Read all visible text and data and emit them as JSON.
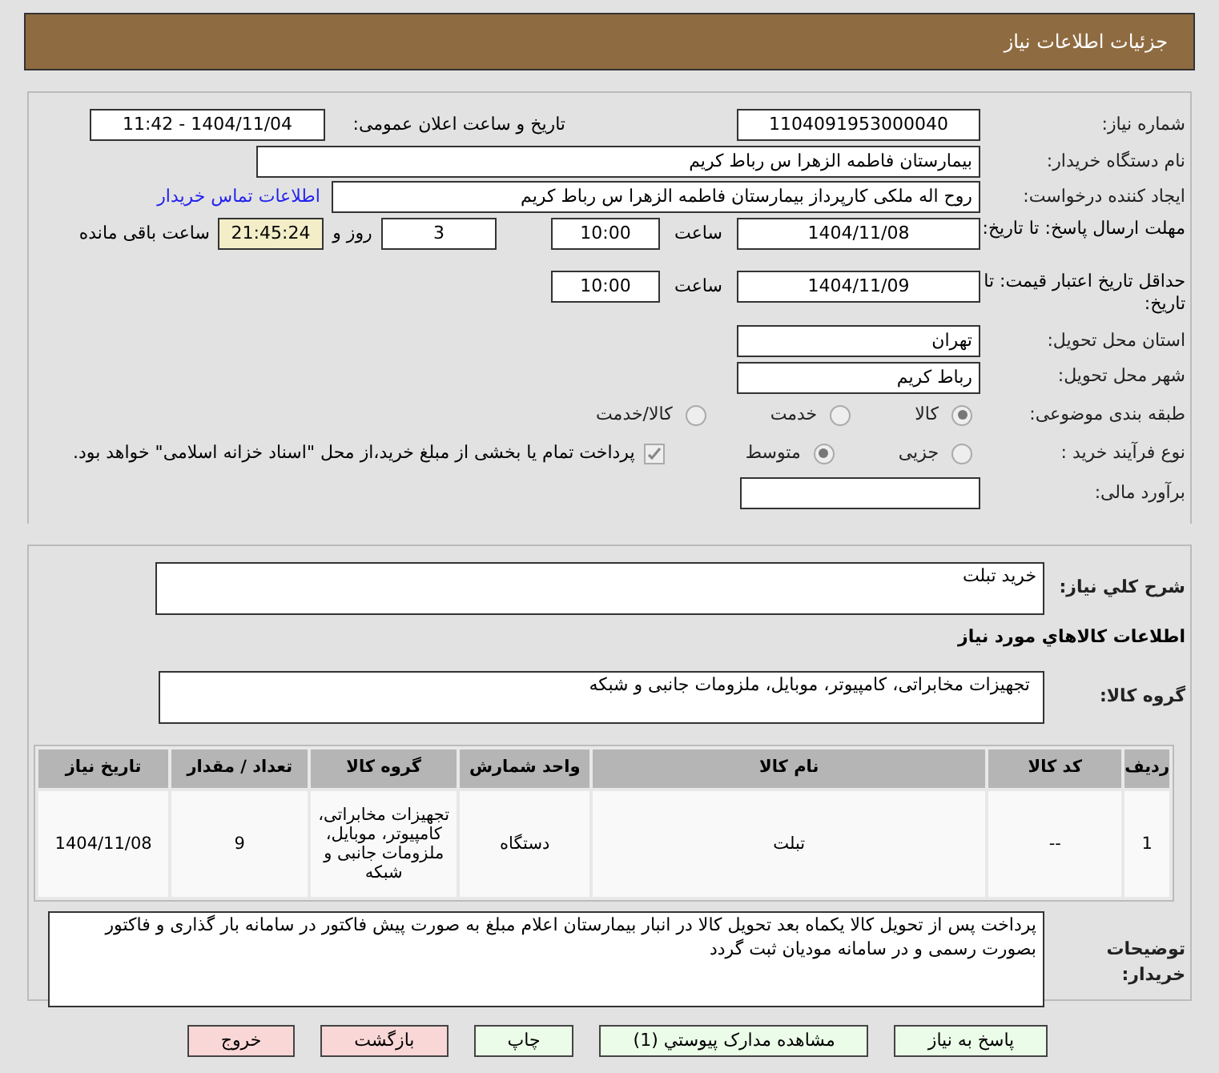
{
  "header": {
    "title": "جزئیات اطلاعات نیاز"
  },
  "need_number": {
    "label": "شماره نیاز:",
    "value": "1104091953000040"
  },
  "announce": {
    "label": "تاریخ و ساعت اعلان عمومی:",
    "value": "1404/11/04 - 11:42"
  },
  "buyer": {
    "label": "نام دستگاه خریدار:",
    "value": "بیمارستان فاطمه الزهرا س  رباط کریم"
  },
  "creator": {
    "label": "ایجاد کننده درخواست:",
    "value": "روح اله ملکی کارپرداز  بیمارستان فاطمه الزهرا س  رباط کریم",
    "link": "اطلاعات تماس خریدار"
  },
  "reply_deadline": {
    "label": "مهلت ارسال پاسخ: تا تاریخ:",
    "date": "1404/11/08",
    "time_label": "ساعت",
    "time": "10:00",
    "days": "3",
    "days_label": "روز و",
    "remaining": "21:45:24",
    "remaining_label": "ساعت باقی مانده"
  },
  "price_validity": {
    "label": "حداقل تاریخ اعتبار قیمت: تا تاریخ:",
    "date": "1404/11/09",
    "time_label": "ساعت",
    "time": "10:00"
  },
  "province": {
    "label": "استان محل تحویل:",
    "value": "تهران"
  },
  "city": {
    "label": "شهر محل تحویل:",
    "value": "رباط کریم"
  },
  "category": {
    "label": "طبقه بندی موضوعی:",
    "options": [
      {
        "label": "کالا",
        "selected": true
      },
      {
        "label": "خدمت",
        "selected": false
      },
      {
        "label": "کالا/خدمت",
        "selected": false
      }
    ]
  },
  "purchase_type": {
    "label": "نوع فرآیند خرید :",
    "options": [
      {
        "label": "جزیی",
        "selected": false
      },
      {
        "label": "متوسط",
        "selected": true
      }
    ],
    "payment": {
      "label": "پرداخت تمام یا بخشی از مبلغ خرید،از محل \"اسناد خزانه اسلامی\" خواهد بود.",
      "checked": true
    }
  },
  "estimate": {
    "label": "برآورد مالی:"
  },
  "description": {
    "label": "شرح کلي نیاز:",
    "value": "خرید تبلت"
  },
  "goods_title": "اطلاعات کالاهاي مورد نیاز",
  "goods_group": {
    "label": "گروه کالا:",
    "value": "تجهیزات مخابراتی، کامپیوتر، موبایل، ملزومات جانبی و شبکه"
  },
  "table": {
    "columns": [
      "ردیف",
      "کد کالا",
      "نام کالا",
      "واحد شمارش",
      "گروه کالا",
      "تعداد / مقدار",
      "تاریخ نیاز"
    ],
    "rows": [
      [
        "1",
        "--",
        "تبلت",
        "دستگاه",
        "تجهیزات مخابراتی، کامپیوتر، موبایل، ملزومات جانبی و شبکه",
        "9",
        "1404/11/08"
      ]
    ]
  },
  "buyer_notes": {
    "label": "توضیحات خریدار:",
    "value": "پرداخت پس از تحویل کالا یکماه بعد تحویل کالا در انبار بیمارستان اعلام مبلغ به صورت پیش فاکتور در سامانه بار گذاری و فاکتور بصورت رسمی و در سامانه مودیان ثبت گردد"
  },
  "buttons": [
    {
      "label": "پاسخ به نیاز",
      "kind": "action"
    },
    {
      "label": "مشاهده مدارک پیوستي (1)",
      "kind": "action"
    },
    {
      "label": "چاپ",
      "kind": "action"
    },
    {
      "label": "بازگشت",
      "kind": "exit"
    },
    {
      "label": "خروج",
      "kind": "exit"
    }
  ]
}
